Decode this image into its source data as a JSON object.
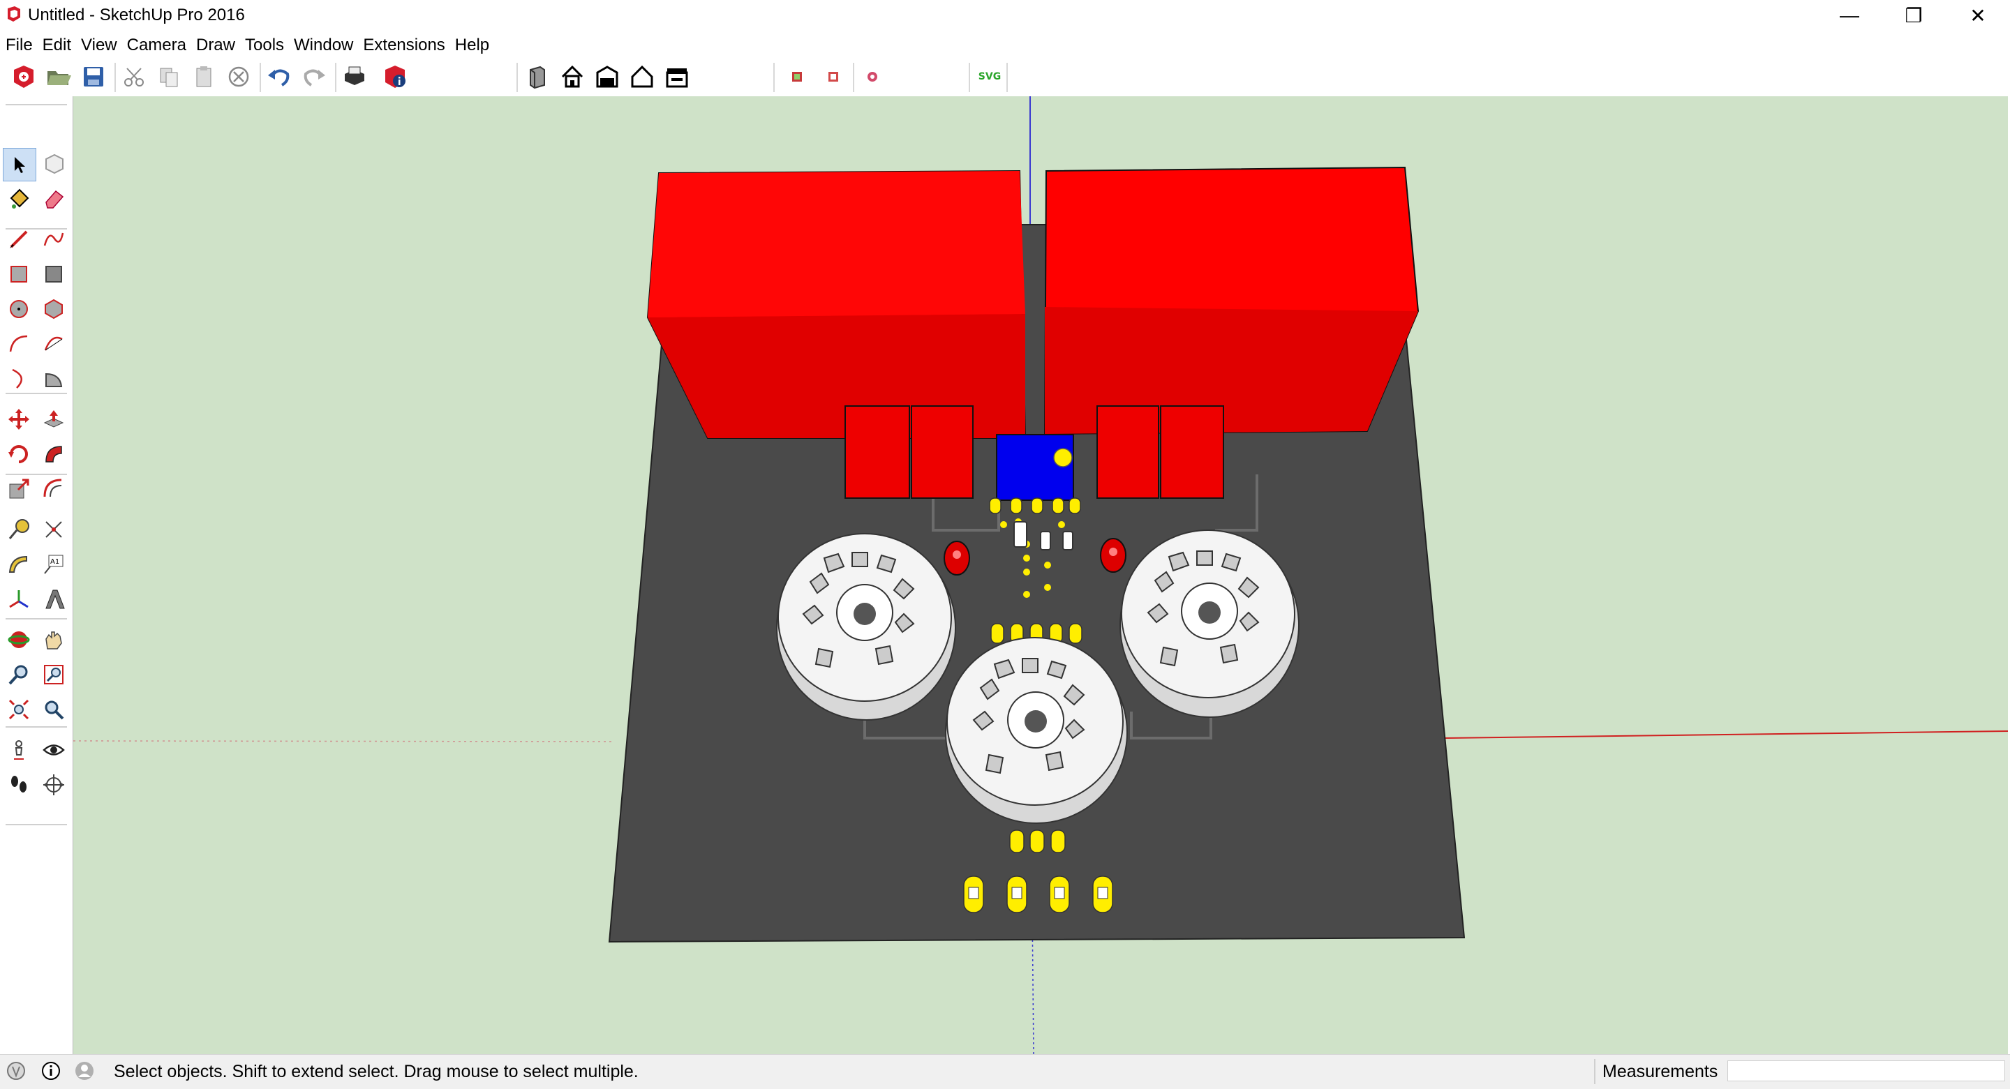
{
  "window": {
    "title": "Untitled - SketchUp Pro 2016",
    "controls": {
      "minimize": "—",
      "maximize": "❐",
      "close": "✕"
    }
  },
  "menu": [
    "File",
    "Edit",
    "View",
    "Camera",
    "Draw",
    "Tools",
    "Window",
    "Extensions",
    "Help"
  ],
  "toolbar": {
    "icons": [
      "new-file-icon",
      "open-folder-icon",
      "save-icon",
      "cut-icon",
      "copy-icon",
      "paste-icon",
      "erase-circle-icon",
      "undo-icon",
      "redo-icon",
      "print-icon",
      "model-info-icon",
      "standard-views-iso-icon",
      "home-view-icon",
      "front-view-icon",
      "right-view-icon",
      "back-view-icon",
      "export-red-icon",
      "export-red-2-icon",
      "export-pink-icon"
    ],
    "svg_label": "SVG"
  },
  "palette": {
    "tools": [
      "select-icon",
      "make-component-icon",
      "paint-bucket-icon",
      "eraser-icon",
      "line-icon",
      "freehand-icon",
      "rectangle-icon",
      "rotated-rectangle-icon",
      "circle-icon",
      "polygon-icon",
      "arc-icon",
      "two-point-arc-icon",
      "three-point-arc-icon",
      "pie-icon",
      "move-icon",
      "push-pull-icon",
      "rotate-icon",
      "follow-me-icon",
      "scale-icon",
      "offset-icon",
      "tape-measure-icon",
      "dimension-icon",
      "protractor-icon",
      "text-icon",
      "axes-icon",
      "3d-text-icon",
      "orbit-icon",
      "pan-icon",
      "zoom-icon",
      "zoom-window-icon",
      "zoom-extents-icon",
      "previous-view-icon",
      "position-camera-icon",
      "look-around-icon",
      "walk-icon",
      "section-plane-icon"
    ]
  },
  "status": {
    "message": "Select objects. Shift to extend select. Drag mouse to select multiple.",
    "measurements_label": "Measurements",
    "measurements_value": ""
  },
  "colors": {
    "viewport_bg": "#cfe2c8",
    "board": "#4a4a4a",
    "transformer": "#ff0000",
    "capacitor": "#ee0000",
    "ic": "#0000ee",
    "pad": "#ffee00",
    "socket": "#f2f2f2"
  }
}
